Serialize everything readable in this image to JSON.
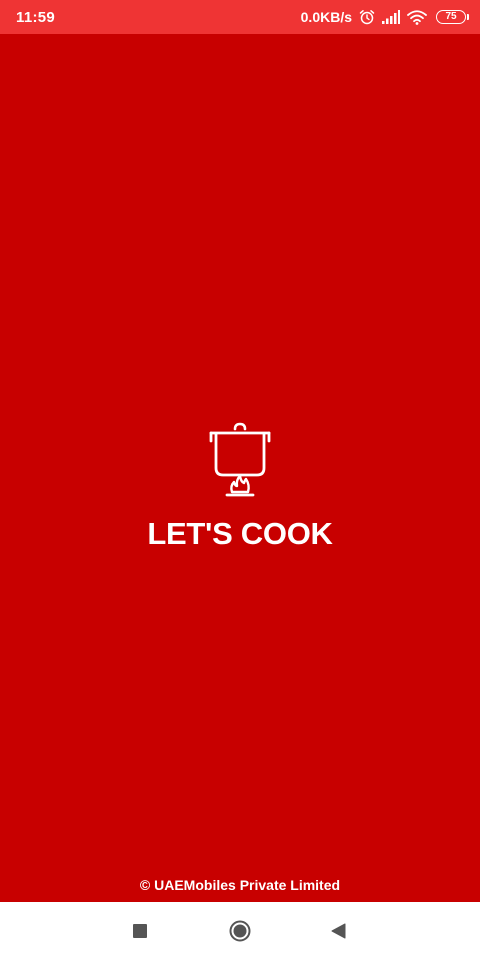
{
  "status_bar": {
    "time": "11:59",
    "net_speed": "0.0KB/s",
    "battery_level": "75",
    "icons": [
      "alarm-icon",
      "signal-icon",
      "wifi-icon",
      "battery-icon"
    ]
  },
  "splash": {
    "app_name": "LET'S COOK",
    "logo_icon": "cooking-pot-icon"
  },
  "footer": {
    "copyright": "© UAEMobiles Private Limited"
  },
  "nav_bar": {
    "buttons": [
      "recents-button",
      "home-button",
      "back-button"
    ]
  },
  "colors": {
    "background": "#c80000",
    "status_bar": "#ef3434",
    "text": "#ffffff",
    "nav_bar": "#ffffff",
    "nav_icons": "#555555"
  }
}
